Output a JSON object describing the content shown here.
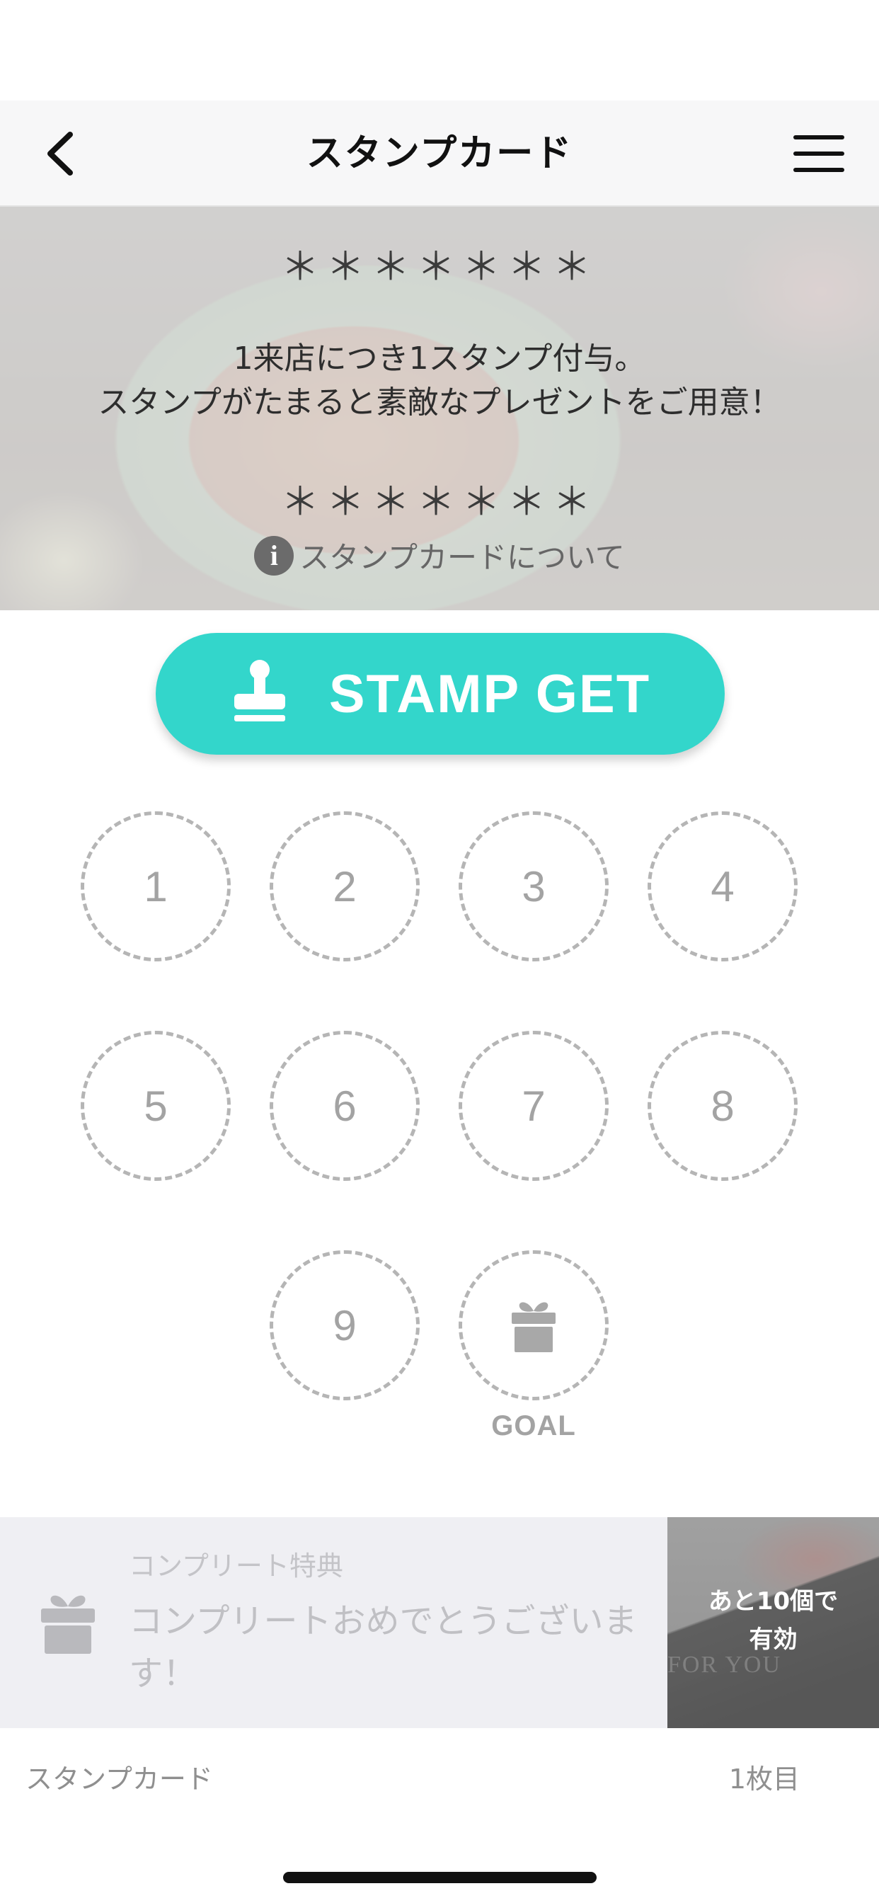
{
  "header": {
    "title": "スタンプカード",
    "back_icon": "chevron-left-icon",
    "menu_icon": "hamburger-menu-icon"
  },
  "hero": {
    "stars_top": "＊＊＊＊＊＊＊",
    "line1": "1来店につき1スタンプ付与。",
    "line2": "スタンプがたまると素敵なプレゼントをご用意！",
    "stars_bottom": "＊＊＊＊＊＊＊",
    "about_link": "スタンプカードについて",
    "info_icon_glyph": "i"
  },
  "stamp_button": {
    "label": "STAMP GET",
    "icon": "stamp-icon",
    "color": "#33d6cb"
  },
  "stamps": {
    "slots": [
      "1",
      "2",
      "3",
      "4",
      "5",
      "6",
      "7",
      "8",
      "9"
    ],
    "goal_icon": "gift-icon",
    "goal_label": "GOAL",
    "collected": 0
  },
  "reward": {
    "caption": "コンプリート特典",
    "title": "コンプリートおめでとうございます！",
    "remaining_line1": "あと10個で",
    "remaining_line2": "有効",
    "image_text": "FOR YOU",
    "icon": "gift-icon"
  },
  "footer": {
    "left": "スタンプカード",
    "right": "1枚目"
  }
}
